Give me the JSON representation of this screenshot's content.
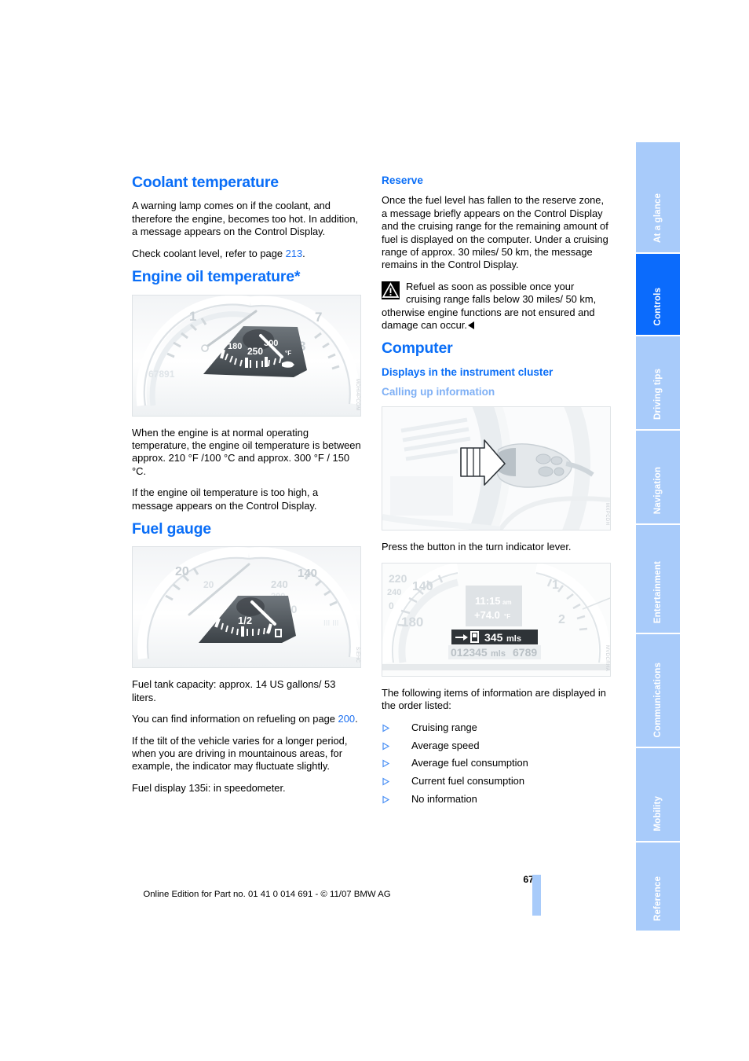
{
  "document": {
    "page_number": "67",
    "footer_line": "Online Edition for Part no. 01 41 0 014 691 - © 11/07 BMW AG"
  },
  "left_column": {
    "coolant": {
      "heading": "Coolant temperature",
      "paragraph_1": "A warning lamp comes on if the coolant, and therefore the engine, becomes too hot. In addition, a message appears on the Control Display.",
      "paragraph_2_before": "Check coolant level, refer to page ",
      "paragraph_2_ref": "213",
      "paragraph_2_after": "."
    },
    "engine_oil": {
      "heading": "Engine oil temperature*",
      "figure": {
        "name": "engine-oil-temperature-gauge",
        "code": "MOHI4PCOM",
        "gauge_labels": [
          "180",
          "250",
          "300",
          "°F"
        ],
        "dial_numbers": [
          "1",
          "7",
          "8"
        ],
        "odometer": "67891"
      },
      "paragraph_1": "When the engine is at normal operating temperature, the engine oil temperature is between approx. 210 °F /100 °C and approx. 300 °F / 150 °C.",
      "paragraph_2": "If the engine oil temperature is too high, a message appears on the Control Display."
    },
    "fuel_gauge": {
      "heading": "Fuel gauge",
      "figure": {
        "name": "fuel-gauge",
        "code": "SIEHC",
        "gauge_labels": [
          "0",
          "1/2"
        ],
        "dial_numbers": [
          "20",
          "240",
          "140",
          "160"
        ]
      },
      "paragraph_1": "Fuel tank capacity: approx. 14 US gallons/ 53 liters.",
      "paragraph_2_before": "You can find information on refueling on page ",
      "paragraph_2_ref": "200",
      "paragraph_2_after": ".",
      "paragraph_3": "If the tilt of the vehicle varies for a longer period, when you are driving in mountainous areas, for example, the indicator may fluctuate slightly.",
      "paragraph_4": "Fuel display 135i: in speedometer."
    }
  },
  "right_column": {
    "reserve": {
      "heading": "Reserve",
      "paragraph_1": "Once the fuel level has fallen to the reserve zone, a message briefly appears on the Control Display and the cruising range for the remaining amount of fuel is displayed on the computer. Under a cruising range of approx. 30 miles/ 50 km, the message remains in the Control Display.",
      "warning": "Refuel as soon as possible once your cruising range falls below 30 miles/ 50 km, otherwise engine functions are not ensured and damage can occur."
    },
    "computer": {
      "heading": "Computer",
      "sub_heading": "Displays in the instrument cluster",
      "sub_sub_heading": "Calling up information",
      "figure_lever": {
        "name": "turn-indicator-lever",
        "code": "MXPCDH"
      },
      "caption_lever": "Press the button in the turn indicator lever.",
      "figure_cluster": {
        "name": "instrument-cluster-display",
        "code": "MVDCRHA",
        "time": "11:15 am",
        "temperature": "+74.0 °F",
        "range_value": "345 mls",
        "odometer": "012345 mls",
        "trip": "6789",
        "speed_ticks": [
          "220",
          "240",
          "140",
          "180",
          "0"
        ],
        "rpm_ticks": [
          "1",
          "2"
        ]
      },
      "intro": "The following items of information are displayed in the order listed:",
      "items": [
        "Cruising range",
        "Average speed",
        "Average fuel consumption",
        "Current fuel consumption",
        "No information"
      ]
    }
  },
  "side_tabs": {
    "items": [
      {
        "label": "At a glance",
        "active": false
      },
      {
        "label": "Controls",
        "active": true
      },
      {
        "label": "Driving tips",
        "active": false
      },
      {
        "label": "Navigation",
        "active": false
      },
      {
        "label": "Entertainment",
        "active": false
      },
      {
        "label": "Communications",
        "active": false
      },
      {
        "label": "Mobility",
        "active": false
      },
      {
        "label": "Reference",
        "active": false
      }
    ]
  },
  "colors": {
    "accent_blue": "#0a6ef7",
    "light_blue": "#a8cbfa",
    "active_tab_blue": "#0b6bfc",
    "pale_heading_blue": "#7fb0f5"
  }
}
